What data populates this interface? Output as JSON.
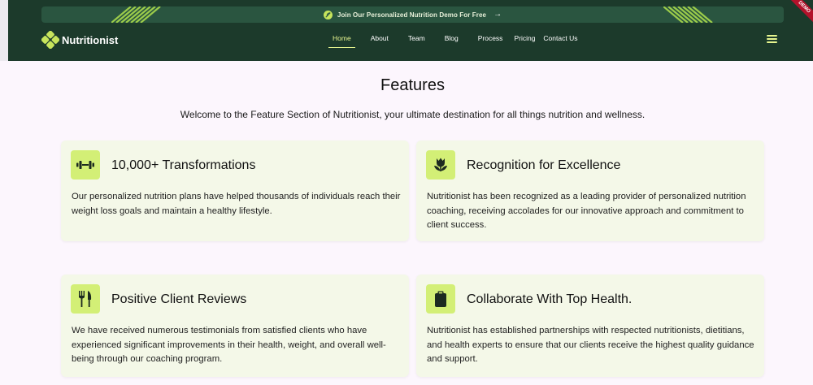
{
  "promo": {
    "text": "Join Our Personalized Nutrition Demo For Free",
    "arrow": "→",
    "icon": "leaf-icon",
    "ribbon_text": "DEMO"
  },
  "brand": {
    "name": "Nutritionist",
    "logo_icon": "nutrition-logo-icon"
  },
  "nav": {
    "items": [
      "Home",
      "About",
      "Team",
      "Blog",
      "Process",
      "Pricing",
      "Contact Us"
    ],
    "active": "Home",
    "menu_icon": "hamburger-menu-icon"
  },
  "features": {
    "title": "Features",
    "intro": "Welcome to the Feature Section of Nutritionist, your ultimate destination for all things nutrition and wellness.",
    "cards": [
      {
        "icon": "dumbbell-icon",
        "title": "10,000+ Transformations",
        "body": "Our personalized nutrition plans have helped thousands of individuals reach their weight loss goals and maintain a healthy lifestyle."
      },
      {
        "icon": "tulip-icon",
        "title": "Recognition for Excellence",
        "body": "Nutritionist has been recognized as a leading provider of personalized nutrition coaching, receiving accolades for our innovative approach and commitment to client success."
      },
      {
        "icon": "fork-knife-icon",
        "title": "Positive Client Reviews",
        "body": "We have received numerous testimonials from satisfied clients who have experienced significant improvements in their health, weight, and overall well-being through our coaching program."
      },
      {
        "icon": "clipboard-icon",
        "title": "Collaborate With Top Health.",
        "body": "Nutritionist has established partnerships with respected nutritionists, dietitians, and health experts to ensure that our clients receive the highest quality guidance and support."
      }
    ]
  },
  "colors": {
    "header_bg": "#1c3a2b",
    "promo_bg": "#2a5540",
    "accent": "#d3ef76",
    "card_bg": "#f4f8e8",
    "page_bg": "#fcf6fd"
  }
}
